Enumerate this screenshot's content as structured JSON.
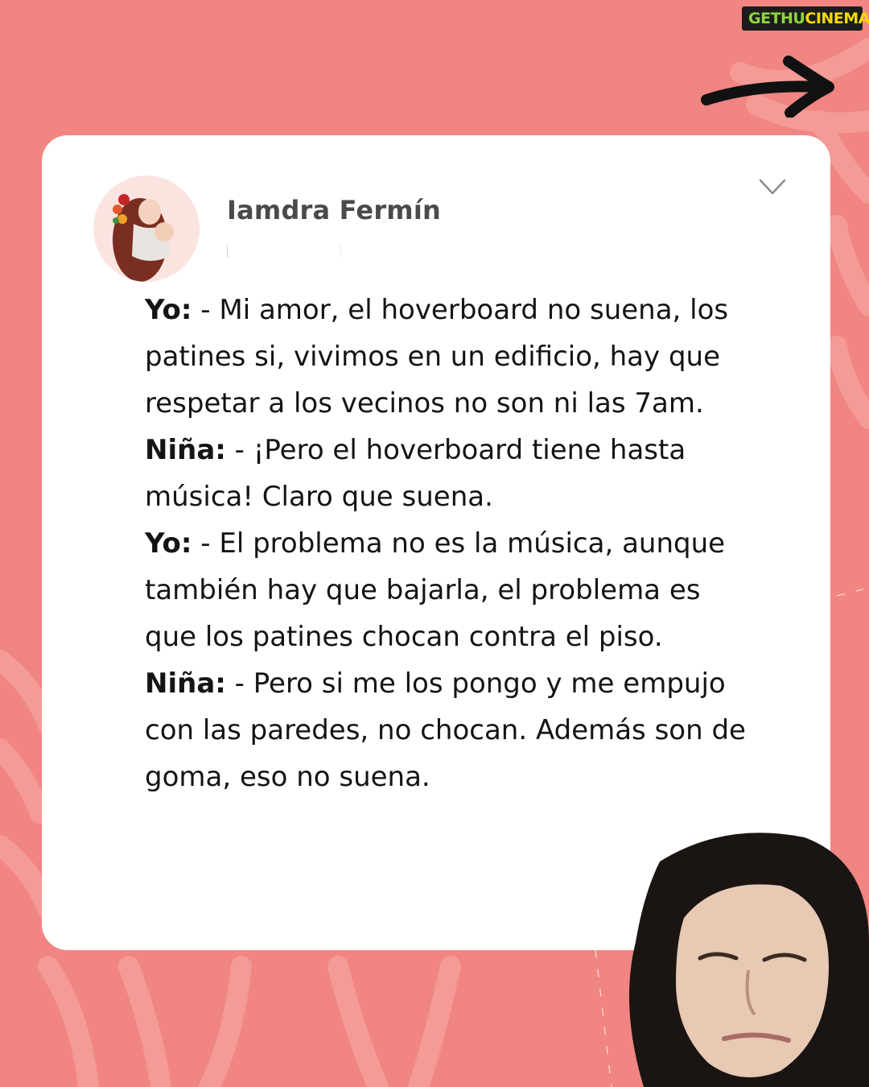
{
  "watermark": {
    "part1": "GETHU",
    "part2": "CINEMA"
  },
  "post": {
    "author": "Iamdra Fermín",
    "dialogue": [
      {
        "speaker": "Yo:",
        "text": " - Mi amor, el hoverboard no suena, los patines si, vivimos en un edificio, hay que respetar a los vecinos no son ni las 7am."
      },
      {
        "speaker": "Niña:",
        "text": " - ¡Pero el hoverboard tiene hasta música! Claro que suena."
      },
      {
        "speaker": "Yo:",
        "text": " - El problema no es la música, aunque también hay que bajarla, el problema es que los patines chocan contra el piso."
      },
      {
        "speaker": "Niña:",
        "text": " - Pero si me los pongo y me empujo con las paredes, no chocan. Además son de goma, eso no suena."
      }
    ]
  },
  "icons": {
    "avatar": "avatar-illustration",
    "menu": "chevron-down-icon",
    "next": "arrow-right-icon"
  },
  "colors": {
    "background": "#f08582",
    "card": "#ffffff",
    "text": "#141414",
    "author": "#4a4a4a"
  }
}
